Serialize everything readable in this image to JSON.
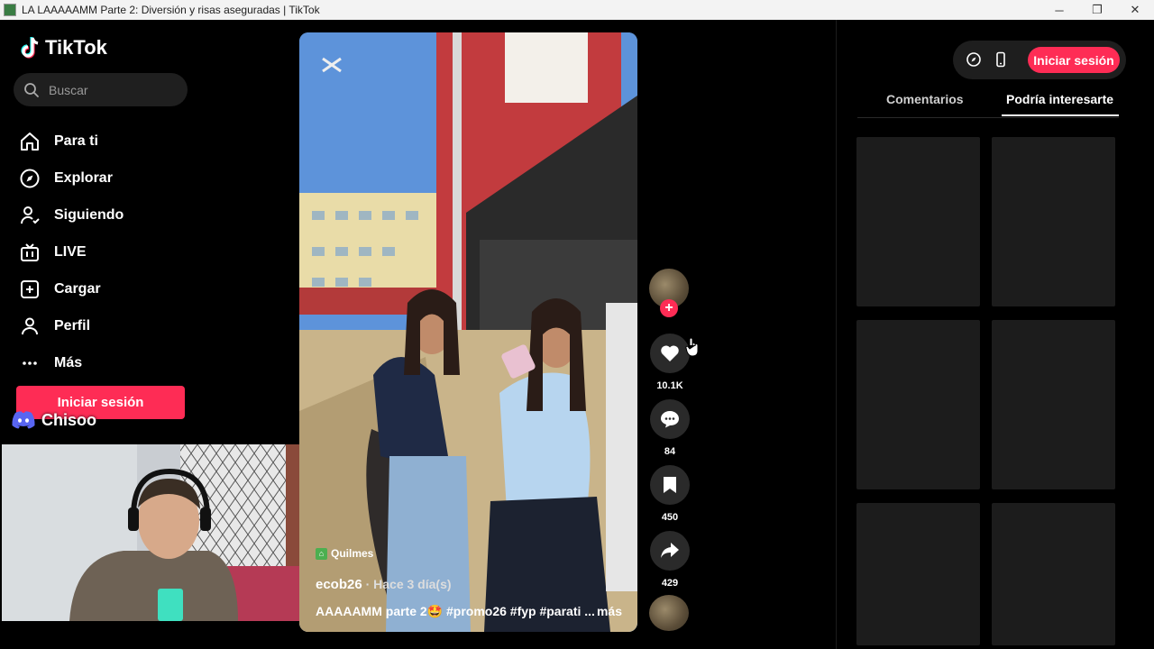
{
  "window": {
    "title": "LA LAAAAAMM Parte 2: Diversión y risas aseguradas | TikTok",
    "controls": [
      "─",
      "❐",
      "✕"
    ]
  },
  "brand": {
    "name": "TikTok"
  },
  "search": {
    "placeholder": "Buscar"
  },
  "nav": {
    "items": [
      {
        "label": "Para ti",
        "icon": "home-icon"
      },
      {
        "label": "Explorar",
        "icon": "compass-icon"
      },
      {
        "label": "Siguiendo",
        "icon": "following-icon"
      },
      {
        "label": "LIVE",
        "icon": "live-tv-icon"
      },
      {
        "label": "Cargar",
        "icon": "upload-icon"
      },
      {
        "label": "Perfil",
        "icon": "profile-icon"
      },
      {
        "label": "Más",
        "icon": "more-dots-icon"
      }
    ],
    "login_label": "Iniciar sesión"
  },
  "overlay": {
    "discord_name": "Chisoo"
  },
  "video": {
    "location": "Quilmes",
    "author": "ecob26",
    "time": " · Hace 3 día(s)",
    "caption": "AAAAAMM parte 2🤩 #promo26 #fyp #parati ...",
    "more_label": "más"
  },
  "actions": {
    "likes": "10.1K",
    "comments": "84",
    "saves": "450",
    "shares": "429"
  },
  "right_panel": {
    "login_label": "Iniciar sesión",
    "tabs": [
      "Comentarios",
      "Podría interesarte"
    ],
    "active_tab": "Podría interesarte"
  },
  "colors": {
    "accent": "#fe2c55",
    "background": "#000000",
    "surface": "#1c1c1c",
    "discord": "#5865f2"
  }
}
